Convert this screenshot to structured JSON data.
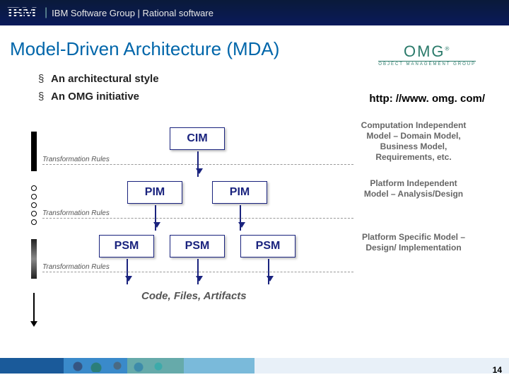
{
  "header": {
    "logo_text": "IBM",
    "group_text": "IBM Software Group | Rational software"
  },
  "title": "Model-Driven Architecture (MDA)",
  "bullets": [
    "An architectural style",
    "An OMG initiative"
  ],
  "omg": {
    "logo_main": "OMG",
    "logo_sub": "OBJECT MANAGEMENT GROUP",
    "url": "http: //www. omg. com/"
  },
  "diagram": {
    "rows": [
      {
        "boxes": [
          "CIM"
        ],
        "rule_label": "Transformation Rules",
        "desc": "Computation Independent Model – Domain Model, Business Model, Requirements, etc."
      },
      {
        "boxes": [
          "PIM",
          "PIM"
        ],
        "rule_label": "Transformation Rules",
        "desc": "Platform Independent Model – Analysis/Design"
      },
      {
        "boxes": [
          "PSM",
          "PSM",
          "PSM"
        ],
        "rule_label": "Transformation Rules",
        "desc": "Platform Specific Model – Design/ Implementation"
      }
    ],
    "output": "Code, Files, Artifacts"
  },
  "page_number": "14"
}
